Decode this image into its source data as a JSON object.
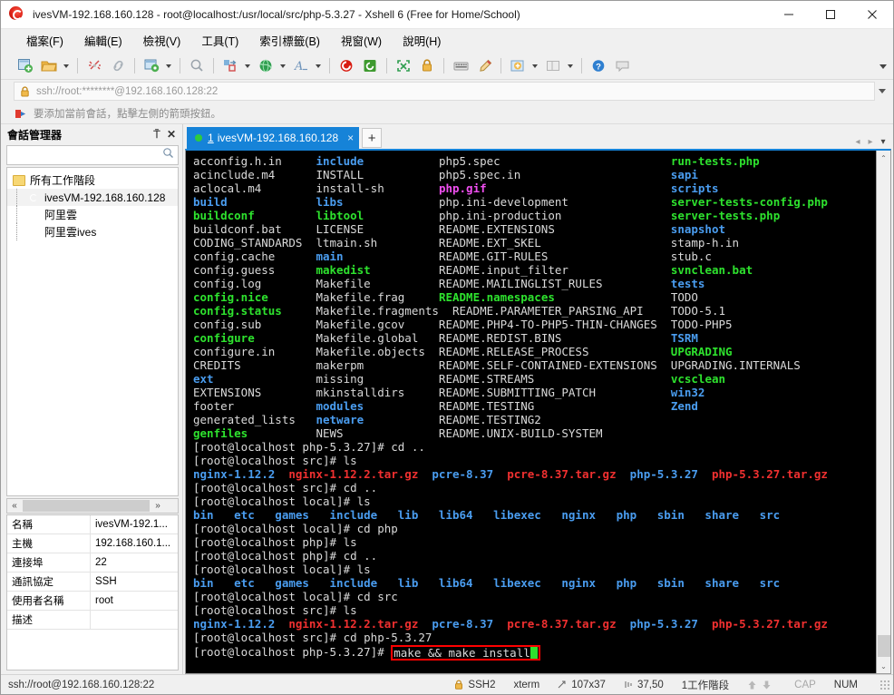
{
  "window": {
    "title": "ivesVM-192.168.160.128 - root@localhost:/usr/local/src/php-5.3.27 - Xshell 6 (Free for Home/School)",
    "app_icon": "xshell-logo-icon",
    "minimize_label": "—",
    "maximize_label": "□",
    "close_label": "✕"
  },
  "menu": {
    "items": [
      {
        "label": "檔案(F)",
        "mnemonic": "F"
      },
      {
        "label": "編輯(E)",
        "mnemonic": "E"
      },
      {
        "label": "檢視(V)",
        "mnemonic": "V"
      },
      {
        "label": "工具(T)",
        "mnemonic": "T"
      },
      {
        "label": "索引標籤(B)",
        "mnemonic": "B"
      },
      {
        "label": "視窗(W)",
        "mnemonic": "W"
      },
      {
        "label": "說明(H)",
        "mnemonic": "H"
      }
    ]
  },
  "toolbar": {
    "icons": [
      "new-session-icon",
      "open-folder-icon",
      "disconnect-icon",
      "link-icon",
      "session-properties-icon",
      "find-icon",
      "transfer-icon",
      "globe-icon",
      "font-icon",
      "xshell-icon",
      "xftp-icon",
      "fullscreen-icon",
      "lock-icon",
      "keyboard-icon",
      "highlight-pen-icon",
      "add-tab-icon",
      "layout-icon",
      "help-icon",
      "comment-icon"
    ],
    "overflow_label": "More toolbar buttons"
  },
  "address_bar": {
    "icon": "lock-icon",
    "value": "ssh://root:********@192.168.160.128:22",
    "placeholder": "ssh://root:********@192.168.160.128:22"
  },
  "hint_bar": {
    "icon": "red-arrow-icon",
    "text": "要添加當前會話，點擊左側的箭頭按鈕。"
  },
  "sidebar": {
    "title": "會話管理器",
    "pin_label": "⍑",
    "close_label": "✕",
    "search": {
      "placeholder": "",
      "value": "",
      "icon": "search-icon"
    },
    "tree": {
      "root": {
        "label": "所有工作階段",
        "icon": "folder-icon"
      },
      "items": [
        {
          "label": "ivesVM-192.168.160.128",
          "icon": "session-icon",
          "selected": true
        },
        {
          "label": "阿里雲",
          "icon": "session-icon",
          "selected": false
        },
        {
          "label": "阿里雲ives",
          "icon": "session-icon",
          "selected": false
        }
      ]
    },
    "hscroll": {
      "left_label": "«",
      "right_label": "»"
    },
    "properties": {
      "rows": [
        {
          "key": "名稱",
          "value": "ivesVM-192.1..."
        },
        {
          "key": "主機",
          "value": "192.168.160.1..."
        },
        {
          "key": "連接埠",
          "value": "22"
        },
        {
          "key": "通訊協定",
          "value": "SSH"
        },
        {
          "key": "使用者名稱",
          "value": "root"
        },
        {
          "key": "描述",
          "value": ""
        }
      ]
    }
  },
  "tabs": {
    "items": [
      {
        "number": "1",
        "label": "ivesVM-192.168.160.128",
        "active": true,
        "status_dot": "#2ecc3d",
        "close_label": "×"
      }
    ],
    "new_tab_label": "+",
    "nav_prev": "◂",
    "nav_next": "▸",
    "nav_list": "▾"
  },
  "terminal": {
    "background": "#000000",
    "colors": {
      "white": "#d9d9d9",
      "blue": "#4a9df0",
      "green": "#2ee22e",
      "red": "#f03030",
      "magenta": "#f14ff1",
      "cyan": "#3ad0e8"
    },
    "lines": [
      {
        "spans": [
          {
            "t": "acconfig.h.in     ",
            "c": "white"
          },
          {
            "t": "include           ",
            "c": "blue"
          },
          {
            "t": "php5.spec                         ",
            "c": "white"
          },
          {
            "t": "run-tests.php",
            "c": "green"
          }
        ]
      },
      {
        "spans": [
          {
            "t": "acinclude.m4      INSTALL           php5.spec.in                      ",
            "c": "white"
          },
          {
            "t": "sapi",
            "c": "blue"
          }
        ]
      },
      {
        "spans": [
          {
            "t": "aclocal.m4        install-sh        ",
            "c": "white"
          },
          {
            "t": "php.gif                           ",
            "c": "magenta"
          },
          {
            "t": "scripts",
            "c": "blue"
          }
        ]
      },
      {
        "spans": [
          {
            "t": "build             libs              ",
            "c": "blue"
          },
          {
            "t": "php.ini-development               ",
            "c": "white"
          },
          {
            "t": "server-tests-config.php",
            "c": "green"
          }
        ]
      },
      {
        "spans": [
          {
            "t": "buildconf         libtool           ",
            "c": "green"
          },
          {
            "t": "php.ini-production                ",
            "c": "white"
          },
          {
            "t": "server-tests.php",
            "c": "green"
          }
        ]
      },
      {
        "spans": [
          {
            "t": "buildconf.bat     LICENSE           README.EXTENSIONS                 ",
            "c": "white"
          },
          {
            "t": "snapshot",
            "c": "blue"
          }
        ]
      },
      {
        "spans": [
          {
            "t": "CODING_STANDARDS  ltmain.sh         README.EXT_SKEL                   stamp-h.in",
            "c": "white"
          }
        ]
      },
      {
        "spans": [
          {
            "t": "config.cache      ",
            "c": "white"
          },
          {
            "t": "main              ",
            "c": "blue"
          },
          {
            "t": "README.GIT-RULES                  stub.c",
            "c": "white"
          }
        ]
      },
      {
        "spans": [
          {
            "t": "config.guess      ",
            "c": "white"
          },
          {
            "t": "makedist          ",
            "c": "green"
          },
          {
            "t": "README.input_filter               ",
            "c": "white"
          },
          {
            "t": "svnclean.bat",
            "c": "green"
          }
        ]
      },
      {
        "spans": [
          {
            "t": "config.log        Makefile          README.MAILINGLIST_RULES          ",
            "c": "white"
          },
          {
            "t": "tests",
            "c": "blue"
          }
        ]
      },
      {
        "spans": [
          {
            "t": "config.nice       ",
            "c": "green"
          },
          {
            "t": "Makefile.frag     ",
            "c": "white"
          },
          {
            "t": "README.namespaces                 ",
            "c": "green"
          },
          {
            "t": "TODO",
            "c": "white"
          }
        ]
      },
      {
        "spans": [
          {
            "t": "config.status     ",
            "c": "green"
          },
          {
            "t": "Makefile.fragments  README.PARAMETER_PARSING_API    TODO-5.1",
            "c": "white"
          }
        ]
      },
      {
        "spans": [
          {
            "t": "config.sub        Makefile.gcov     README.PHP4-TO-PHP5-THIN-CHANGES  TODO-PHP5",
            "c": "white"
          }
        ]
      },
      {
        "spans": [
          {
            "t": "configure         ",
            "c": "green"
          },
          {
            "t": "Makefile.global   README.REDIST.BINS                ",
            "c": "white"
          },
          {
            "t": "TSRM",
            "c": "blue"
          }
        ]
      },
      {
        "spans": [
          {
            "t": "configure.in      Makefile.objects  README.RELEASE_PROCESS            ",
            "c": "white"
          },
          {
            "t": "UPGRADING",
            "c": "green"
          }
        ]
      },
      {
        "spans": [
          {
            "t": "CREDITS           makerpm           README.SELF-CONTAINED-EXTENSIONS  UPGRADING.INTERNALS",
            "c": "white"
          }
        ]
      },
      {
        "spans": [
          {
            "t": "ext               ",
            "c": "blue"
          },
          {
            "t": "missing           README.STREAMS                    ",
            "c": "white"
          },
          {
            "t": "vcsclean",
            "c": "green"
          }
        ]
      },
      {
        "spans": [
          {
            "t": "EXTENSIONS        mkinstalldirs     README.SUBMITTING_PATCH           ",
            "c": "white"
          },
          {
            "t": "win32",
            "c": "blue"
          }
        ]
      },
      {
        "spans": [
          {
            "t": "footer            ",
            "c": "white"
          },
          {
            "t": "modules           ",
            "c": "blue"
          },
          {
            "t": "README.TESTING                    ",
            "c": "white"
          },
          {
            "t": "Zend",
            "c": "blue"
          }
        ]
      },
      {
        "spans": [
          {
            "t": "generated_lists   ",
            "c": "white"
          },
          {
            "t": "netware           ",
            "c": "blue"
          },
          {
            "t": "README.TESTING2",
            "c": "white"
          }
        ]
      },
      {
        "spans": [
          {
            "t": "genfiles          ",
            "c": "green"
          },
          {
            "t": "NEWS              README.UNIX-BUILD-SYSTEM",
            "c": "white"
          }
        ]
      },
      {
        "spans": [
          {
            "t": "[root@localhost php-5.3.27]# cd ..",
            "c": "white"
          }
        ]
      },
      {
        "spans": [
          {
            "t": "[root@localhost src]# ls",
            "c": "white"
          }
        ]
      },
      {
        "spans": [
          {
            "t": "nginx-1.12.2  ",
            "c": "blue"
          },
          {
            "t": "nginx-1.12.2.tar.gz  ",
            "c": "red"
          },
          {
            "t": "pcre-8.37  ",
            "c": "blue"
          },
          {
            "t": "pcre-8.37.tar.gz  ",
            "c": "red"
          },
          {
            "t": "php-5.3.27  ",
            "c": "blue"
          },
          {
            "t": "php-5.3.27.tar.gz",
            "c": "red"
          }
        ]
      },
      {
        "spans": [
          {
            "t": "[root@localhost src]# cd ..",
            "c": "white"
          }
        ]
      },
      {
        "spans": [
          {
            "t": "[root@localhost local]# ls",
            "c": "white"
          }
        ]
      },
      {
        "spans": [
          {
            "t": "bin   etc   games   include   lib   lib64   libexec   nginx   php   sbin   share   src",
            "c": "blue"
          }
        ]
      },
      {
        "spans": [
          {
            "t": "[root@localhost local]# cd php",
            "c": "white"
          }
        ]
      },
      {
        "spans": [
          {
            "t": "[root@localhost php]# ls",
            "c": "white"
          }
        ]
      },
      {
        "spans": [
          {
            "t": "[root@localhost php]# cd ..",
            "c": "white"
          }
        ]
      },
      {
        "spans": [
          {
            "t": "[root@localhost local]# ls",
            "c": "white"
          }
        ]
      },
      {
        "spans": [
          {
            "t": "bin   etc   games   include   lib   lib64   libexec   nginx   php   sbin   share   src",
            "c": "blue"
          }
        ]
      },
      {
        "spans": [
          {
            "t": "[root@localhost local]# cd src",
            "c": "white"
          }
        ]
      },
      {
        "spans": [
          {
            "t": "[root@localhost src]# ls",
            "c": "white"
          }
        ]
      },
      {
        "spans": [
          {
            "t": "nginx-1.12.2  ",
            "c": "blue"
          },
          {
            "t": "nginx-1.12.2.tar.gz  ",
            "c": "red"
          },
          {
            "t": "pcre-8.37  ",
            "c": "blue"
          },
          {
            "t": "pcre-8.37.tar.gz  ",
            "c": "red"
          },
          {
            "t": "php-5.3.27  ",
            "c": "blue"
          },
          {
            "t": "php-5.3.27.tar.gz",
            "c": "red"
          }
        ]
      },
      {
        "spans": [
          {
            "t": "[root@localhost src]# cd php-5.3.27",
            "c": "white"
          }
        ]
      }
    ],
    "prompt_line": {
      "prompt": "[root@localhost php-5.3.27]# ",
      "command": "make && make install",
      "annotation_color": "#ff0000",
      "cursor_color": "#2ee22e"
    },
    "scrollbar": {
      "up": "⌃",
      "down": "⌄"
    }
  },
  "status_bar": {
    "url": "ssh://root@192.168.160.128:22",
    "protocol": "SSH2",
    "term_type": "xterm",
    "size": "107x37",
    "cursor": "37,50",
    "sessions": "1工作階段",
    "cap": "CAP",
    "num": "NUM",
    "up_arrow": "⬆",
    "down_arrow": "⬇"
  }
}
